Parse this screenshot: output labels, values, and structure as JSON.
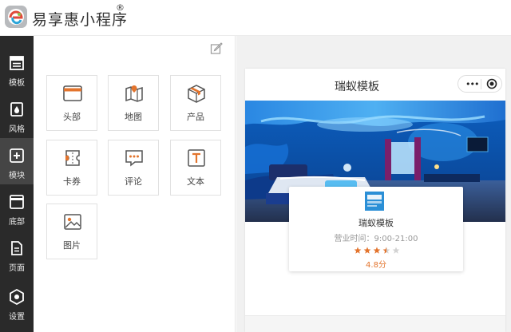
{
  "header": {
    "app_title": "易享惠小程序",
    "registered_mark": "®"
  },
  "sidebar": {
    "items": [
      {
        "label": "模板",
        "icon": "template-icon"
      },
      {
        "label": "风格",
        "icon": "style-icon"
      },
      {
        "label": "模块",
        "icon": "module-add-icon",
        "active": true
      },
      {
        "label": "底部",
        "icon": "footer-icon"
      },
      {
        "label": "页面",
        "icon": "page-icon"
      },
      {
        "label": "设置",
        "icon": "settings-icon"
      }
    ]
  },
  "components": {
    "tiles": [
      {
        "label": "头部",
        "icon": "header-icon"
      },
      {
        "label": "地图",
        "icon": "map-icon"
      },
      {
        "label": "产品",
        "icon": "product-box-icon"
      },
      {
        "label": "卡券",
        "icon": "coupon-icon"
      },
      {
        "label": "评论",
        "icon": "comment-icon"
      },
      {
        "label": "文本",
        "icon": "text-icon"
      },
      {
        "label": "图片",
        "icon": "image-icon"
      }
    ]
  },
  "preview": {
    "page_title": "瑞蚁模板",
    "menu_dots": "•••",
    "store": {
      "name": "瑞蚁模板",
      "hours": "营业时间：9:00-21:00",
      "rating": 3.5,
      "rating_max": 5,
      "score_text": "4.8分"
    }
  },
  "colors": {
    "accent_orange": "#e3742d",
    "sidebar_bg": "#2a2a2a",
    "sidebar_active": "#454545",
    "star_empty": "#d3d3d3"
  }
}
